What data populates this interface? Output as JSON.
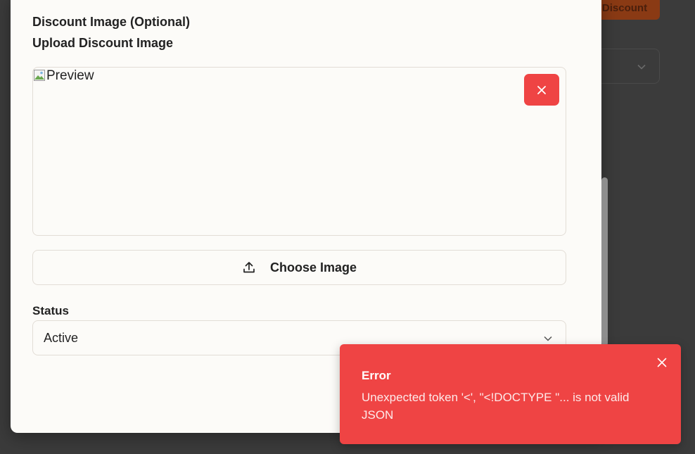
{
  "background": {
    "button_label": "Discount"
  },
  "modal": {
    "section_title": "Discount Image (Optional)",
    "upload_label": "Upload Discount Image",
    "preview_alt": "Preview",
    "choose_button_label": "Choose Image",
    "status_label": "Status",
    "status_value": "Active",
    "icons": {
      "remove": "close-icon",
      "upload": "upload-icon",
      "dropdown": "chevron-down-icon",
      "broken_image": "broken-image-icon"
    }
  },
  "toast": {
    "title": "Error",
    "message": "Unexpected token '<', \"<!DOCTYPE \"... is not valid JSON",
    "close_icon": "close-icon"
  },
  "colors": {
    "danger": "#ef4444",
    "surface": "#fcfbf8",
    "overlay": "#3b3b3b",
    "brand_bg_button": "#8a3a14"
  }
}
